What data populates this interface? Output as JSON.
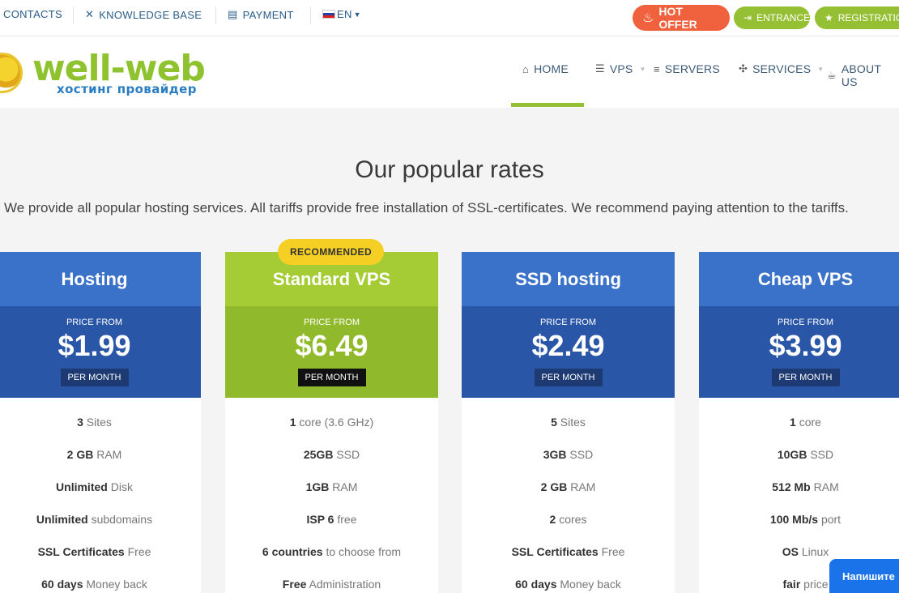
{
  "topbar": {
    "contacts": "CONTACTS",
    "knowledge_base": "KNOWLEDGE BASE",
    "payment": "PAYMENT",
    "language": "EN",
    "hot_offer": "HOT OFFER",
    "entrance": "ENTRANCE",
    "registration": "REGISTRATION"
  },
  "header": {
    "logo_text": "well-web",
    "logo_sub": "хостинг провайдер",
    "nav": {
      "home": "HOME",
      "vps": "VPS",
      "servers": "SERVERS",
      "services": "SERVICES",
      "about": "ABOUT US"
    }
  },
  "hero": {
    "title": "Our popular rates",
    "subtitle": "We provide all popular hosting services. All tariffs provide free installation of SSL-certificates. We recommend paying attention to the tariffs."
  },
  "badge": "RECOMMENDED",
  "price_from": "PRICE FROM",
  "per_month": "PER MONTH",
  "cards": [
    {
      "name": "Hosting",
      "price": "$1.99",
      "features": [
        {
          "strong": "3",
          "rest": " Sites"
        },
        {
          "strong": "2 GB",
          "rest": " RAM"
        },
        {
          "strong": "Unlimited",
          "rest": " Disk"
        },
        {
          "strong": "Unlimited",
          "rest": " subdomains"
        },
        {
          "strong": "SSL Certificates",
          "rest": " Free"
        },
        {
          "strong": "60 days",
          "rest": " Money back"
        }
      ]
    },
    {
      "name": "Standard VPS",
      "price": "$6.49",
      "features": [
        {
          "strong": "1",
          "rest": " core (3.6 GHz)"
        },
        {
          "strong": "25GB",
          "rest": " SSD"
        },
        {
          "strong": "1GB",
          "rest": " RAM"
        },
        {
          "strong": "ISP 6",
          "rest": " free"
        },
        {
          "strong": "6 countries",
          "rest": " to choose from"
        },
        {
          "strong": "Free",
          "rest": " Administration"
        }
      ]
    },
    {
      "name": "SSD hosting",
      "price": "$2.49",
      "features": [
        {
          "strong": "5",
          "rest": " Sites"
        },
        {
          "strong": "3GB",
          "rest": " SSD"
        },
        {
          "strong": "2 GB",
          "rest": " RAM"
        },
        {
          "strong": "2",
          "rest": " cores"
        },
        {
          "strong": "SSL Certificates",
          "rest": " Free"
        },
        {
          "strong": "60 days",
          "rest": " Money back"
        }
      ]
    },
    {
      "name": "Cheap VPS",
      "price": "$3.99",
      "features": [
        {
          "strong": "1",
          "rest": " core"
        },
        {
          "strong": "10GB",
          "rest": " SSD"
        },
        {
          "strong": "512 Mb",
          "rest": " RAM"
        },
        {
          "strong": "100 Mb/s",
          "rest": " port"
        },
        {
          "strong": "OS",
          "rest": " Linux"
        },
        {
          "strong": "fair",
          "rest": " price"
        }
      ]
    }
  ],
  "chat_label": "Напишите",
  "colors": {
    "accent_green": "#96c034",
    "card_blue": "#3b72c9",
    "card_blue_dark": "#2a56a8",
    "hot_offer": "#f0613d",
    "badge_yellow": "#f6cf24"
  }
}
